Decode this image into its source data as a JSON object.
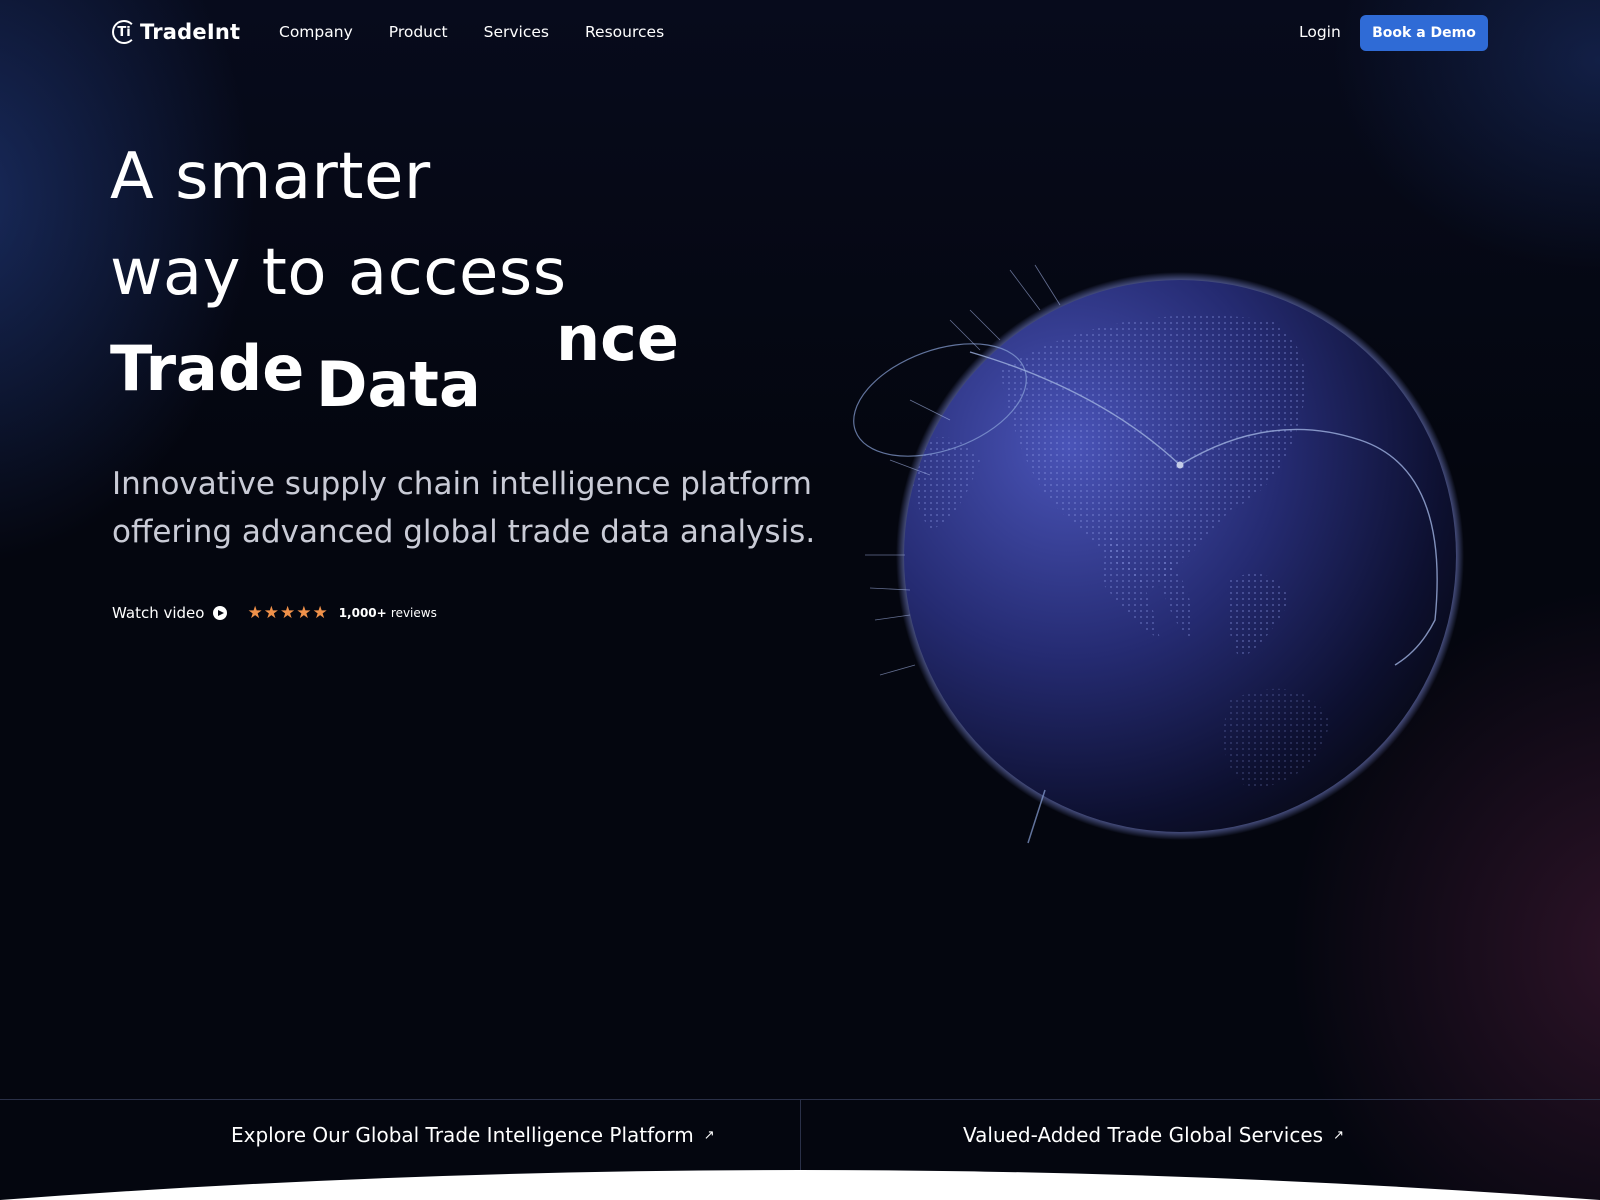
{
  "brand": {
    "logo_mark": "Ti",
    "name": "TradeInt"
  },
  "nav": {
    "items": [
      {
        "label": "Company"
      },
      {
        "label": "Product"
      },
      {
        "label": "Services"
      },
      {
        "label": "Resources"
      }
    ],
    "login_label": "Login",
    "demo_label": "Book a Demo"
  },
  "colors": {
    "accent": "#2f6bd6",
    "star": "#f0914a",
    "background": "#04060f"
  },
  "hero": {
    "line1": "A smarter",
    "line2": "way to access",
    "rotating_word_1": "Trade",
    "rotating_word_2": "Data",
    "rotating_word_partial": "nce",
    "subtitle": "Innovative supply chain intelligence platform offering advanced global trade data analysis.",
    "watch_video_label": "Watch video",
    "play_icon": "play-circle-icon",
    "rating_stars": 5,
    "star_glyph": "★",
    "reviews_count": "1,000+",
    "reviews_label": "reviews"
  },
  "bottom": {
    "link1": "Explore Our Global Trade Intelligence Platform",
    "link2": "Valued-Added Trade Global Services",
    "arrow_glyph": "↗"
  }
}
